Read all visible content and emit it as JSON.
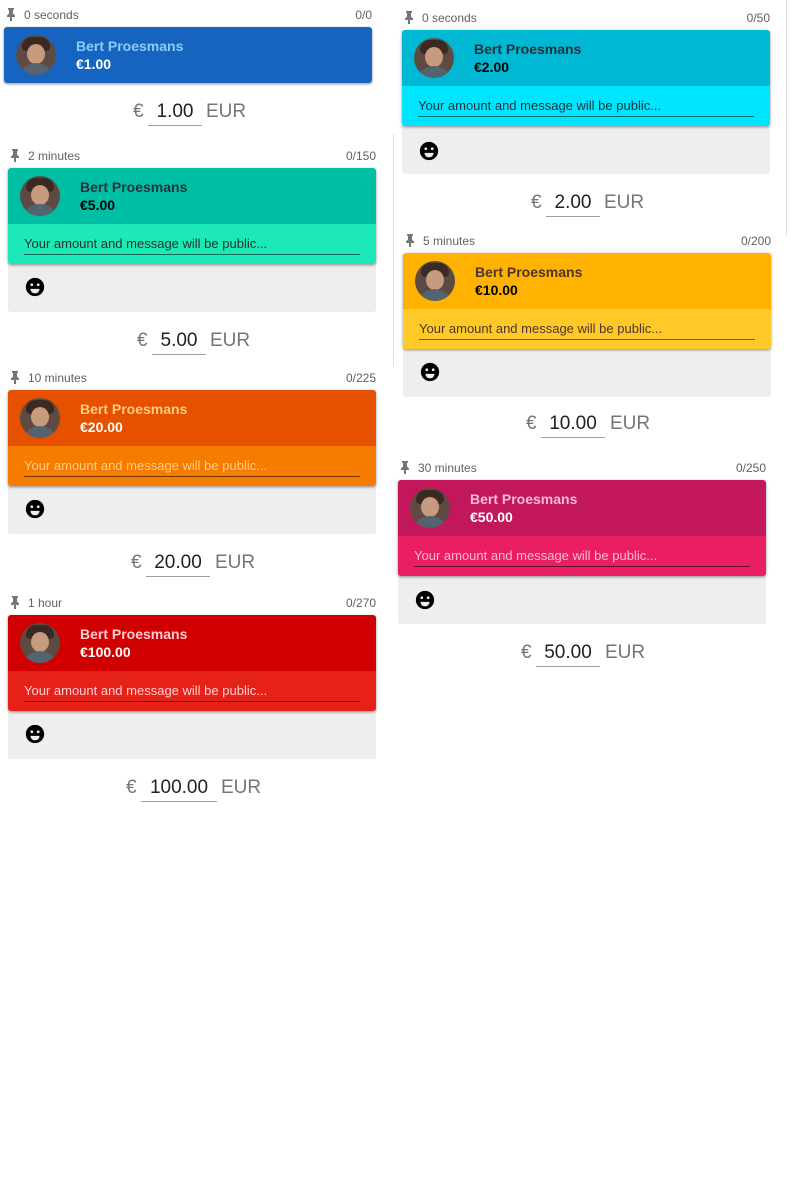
{
  "message_placeholder": "Your amount and message will be public...",
  "currency_symbol": "€",
  "currency_code": "EUR",
  "tiers": [
    {
      "id": "t1",
      "duration": "0 seconds",
      "count": "0/0",
      "name": "Bert Proesmans",
      "amount": "€1.00",
      "value": "1.00",
      "header_color": "#1565c0",
      "name_color": "#90caf9",
      "amount_color": "#ffffff",
      "has_message": false
    },
    {
      "id": "t2",
      "duration": "0 seconds",
      "count": "0/50",
      "name": "Bert Proesmans",
      "amount": "€2.00",
      "value": "2.00",
      "header_color": "#00b8d4",
      "bar_color": "#00e5ff",
      "name_color": "#263238",
      "amount_color": "#000000",
      "has_message": true
    },
    {
      "id": "t5",
      "duration": "2 minutes",
      "count": "0/150",
      "name": "Bert Proesmans",
      "amount": "€5.00",
      "value": "5.00",
      "header_color": "#00bfa5",
      "bar_color": "#1de9b6",
      "name_color": "#263238",
      "amount_color": "#000000",
      "has_message": true
    },
    {
      "id": "t10",
      "duration": "5 minutes",
      "count": "0/200",
      "name": "Bert Proesmans",
      "amount": "€10.00",
      "value": "10.00",
      "header_color": "#ffb300",
      "bar_color": "#ffca28",
      "name_color": "#4e342e",
      "amount_color": "#000000",
      "has_message": true
    },
    {
      "id": "t20",
      "duration": "10 minutes",
      "count": "0/225",
      "name": "Bert Proesmans",
      "amount": "€20.00",
      "value": "20.00",
      "header_color": "#e65100",
      "bar_color": "#f57c00",
      "name_color": "#ffcc80",
      "amount_color": "#ffffff",
      "has_message": true
    },
    {
      "id": "t50",
      "duration": "30 minutes",
      "count": "0/250",
      "name": "Bert Proesmans",
      "amount": "€50.00",
      "value": "50.00",
      "header_color": "#c2185b",
      "bar_color": "#e91e63",
      "name_color": "#f8bbd0",
      "amount_color": "#ffffff",
      "has_message": true
    },
    {
      "id": "t100",
      "duration": "1 hour",
      "count": "0/270",
      "name": "Bert Proesmans",
      "amount": "€100.00",
      "value": "100.00",
      "header_color": "#d00000",
      "bar_color": "#e62117",
      "name_color": "#ffcdd2",
      "amount_color": "#ffffff",
      "has_message": true
    }
  ]
}
